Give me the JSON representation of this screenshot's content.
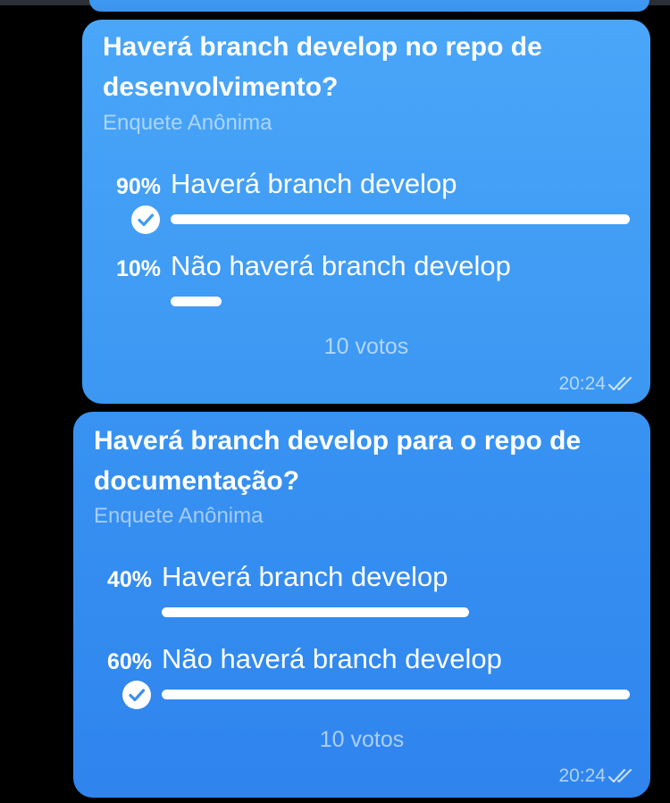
{
  "polls": [
    {
      "question": "Haverá branch develop no repo de desenvolvimento?",
      "subtitle": "Enquete Anônima",
      "options": [
        {
          "percent": "90%",
          "label": "Haverá branch develop",
          "fill": 1.0,
          "selected": true
        },
        {
          "percent": "10%",
          "label": "Não haverá branch develop",
          "fill": 0.11,
          "selected": false
        }
      ],
      "votes": "10 votos",
      "time": "20:24",
      "read_status_icon": "double-check-icon"
    },
    {
      "question": "Haverá branch develop para o repo de documentação?",
      "subtitle": "Enquete Anônima",
      "options": [
        {
          "percent": "40%",
          "label": "Haverá branch develop",
          "fill": 0.67,
          "selected": false
        },
        {
          "percent": "60%",
          "label": "Não haverá branch develop",
          "fill": 1.0,
          "selected": true
        }
      ],
      "votes": "10 votos",
      "time": "20:24",
      "read_status_icon": "double-check-icon"
    }
  ],
  "colors": {
    "background": "#000000",
    "bubble_top": "#4aa6f8",
    "bubble_bottom": "#2f84ed",
    "text": "#ffffff"
  }
}
